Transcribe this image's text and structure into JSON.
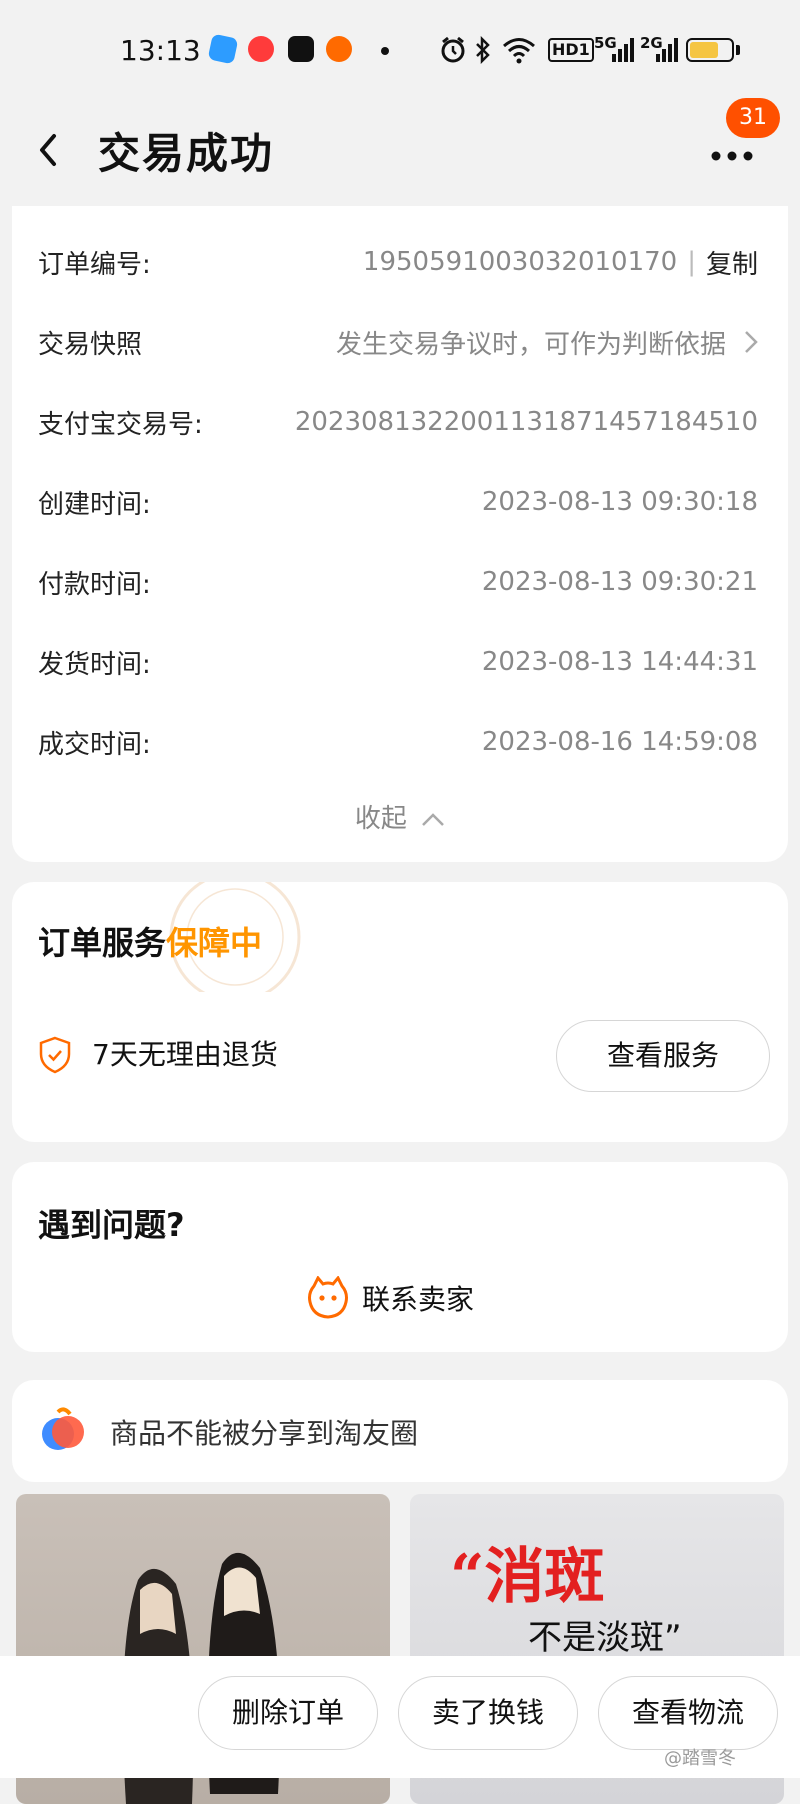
{
  "status_bar": {
    "time": "13:13",
    "wifi_label": "HD1",
    "signal_5g": "5G",
    "signal_2g": "2G",
    "battery_level": 0.7,
    "icons": [
      "alarm-icon",
      "bluetooth-icon",
      "wifi-icon",
      "signal-icon",
      "battery-icon"
    ]
  },
  "header": {
    "title": "交易成功",
    "badge_count": "31"
  },
  "order_info": {
    "rows": [
      {
        "label": "订单编号:",
        "value": "1950591003032010170"
      },
      {
        "label": "交易快照",
        "value": "发生交易争议时，可作为判断依据"
      },
      {
        "label": "支付宝交易号:",
        "value": "2023081322001131871457184510"
      },
      {
        "label": "创建时间:",
        "value": "2023-08-13 09:30:18"
      },
      {
        "label": "付款时间:",
        "value": "2023-08-13 09:30:21"
      },
      {
        "label": "发货时间:",
        "value": "2023-08-13 14:44:31"
      },
      {
        "label": "成交时间:",
        "value": "2023-08-16 14:59:08"
      }
    ],
    "copy_sep": "|",
    "copy_label": "复制",
    "collapse_label": "收起"
  },
  "service": {
    "title_prefix": "订单服务",
    "title_highlight": "保障中",
    "item": "7天无理由退货",
    "button": "查看服务",
    "highlight_color": "#ff9500"
  },
  "problem": {
    "title": "遇到问题?",
    "contact": "联系卖家"
  },
  "share": {
    "text": "商品不能被分享到淘友圈"
  },
  "recommend": {
    "right_main": "“消斑",
    "right_sub": "不是淡斑”"
  },
  "bottom_bar": {
    "delete": "删除订单",
    "sell": "卖了换钱",
    "logistics": "查看物流"
  },
  "watermark": "@踏雪冬",
  "colors": {
    "accent": "#ff5000",
    "highlight": "#ff9500"
  }
}
